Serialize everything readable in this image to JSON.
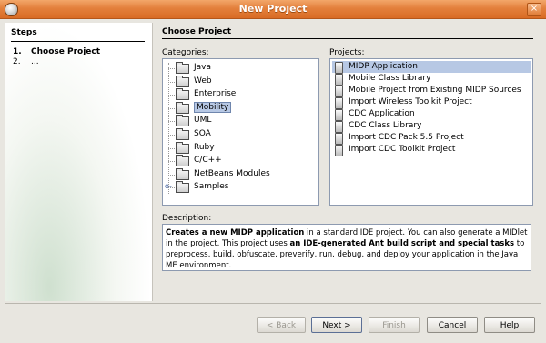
{
  "window": {
    "title": "New Project",
    "close_glyph": "×"
  },
  "steps": {
    "header": "Steps",
    "items": [
      {
        "num": "1.",
        "label": "Choose Project",
        "bold": true
      },
      {
        "num": "2.",
        "label": "...",
        "bold": false
      }
    ]
  },
  "panel": {
    "title": "Choose Project",
    "categories_label": "Categories:",
    "projects_label": "Projects:",
    "description_label": "Description:"
  },
  "categories": [
    "Java",
    "Web",
    "Enterprise",
    "Mobility",
    "UML",
    "SOA",
    "Ruby",
    "C/C++",
    "NetBeans Modules",
    "Samples"
  ],
  "selected_category": "Mobility",
  "projects": [
    "MIDP Application",
    "Mobile Class Library",
    "Mobile Project from Existing MIDP Sources",
    "Import Wireless Toolkit Project",
    "CDC Application",
    "CDC Class Library",
    "Import CDC Pack 5.5 Project",
    "Import CDC Toolkit Project"
  ],
  "selected_project": "MIDP Application",
  "description": {
    "part1_bold": "Creates a new MIDP application",
    "part2": " in a standard IDE project. You can also generate a MIDlet in the project. This project uses ",
    "part3_bold": "an IDE-generated Ant build script and special tasks",
    "part4": " to preprocess, build, obfuscate, preverify, run, debug, and deploy your application in the Java ME environment."
  },
  "buttons": {
    "back": "< Back",
    "next": "Next >",
    "finish": "Finish",
    "cancel": "Cancel",
    "help": "Help"
  },
  "colors": {
    "titlebar": "#e3803c",
    "selection": "#b7c8e4"
  }
}
